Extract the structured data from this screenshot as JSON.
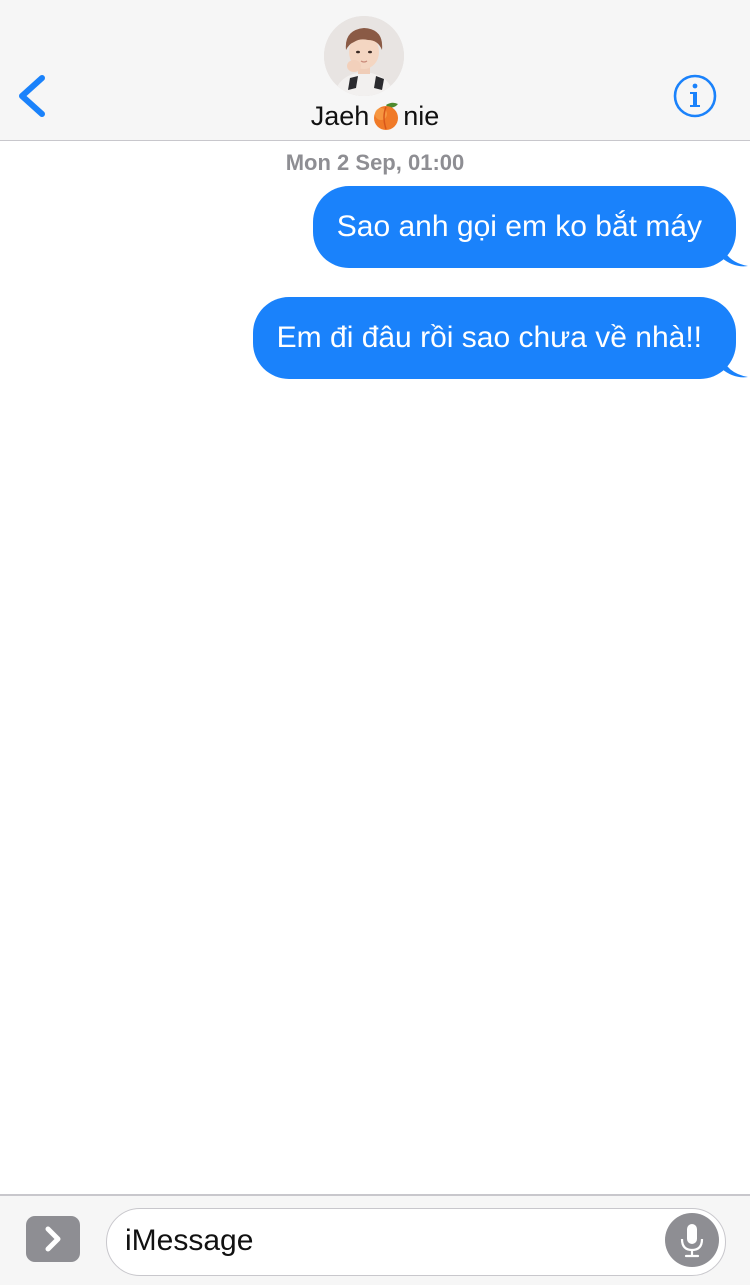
{
  "header": {
    "back_icon": "chevron-left-icon",
    "contact": {
      "name_prefix": "Jaeh",
      "name_emoji": "peach-emoji",
      "name_suffix": "nie",
      "avatar": "contact-avatar-photo"
    },
    "info_icon": "info-circle-icon"
  },
  "conversation": {
    "timestamp": "Mon 2 Sep, 01:00",
    "messages": [
      {
        "direction": "outgoing",
        "text": "Sao anh gọi em ko bắt máy"
      },
      {
        "direction": "outgoing",
        "text": "Em đi đâu rồi sao chưa về nhà!!"
      }
    ]
  },
  "input_bar": {
    "apps_icon": "chevron-right-icon",
    "placeholder": "iMessage",
    "mic_icon": "microphone-icon"
  },
  "colors": {
    "accent": "#1a82fb",
    "header_bg": "#f6f6f6",
    "secondary_text": "#8e8e93"
  }
}
